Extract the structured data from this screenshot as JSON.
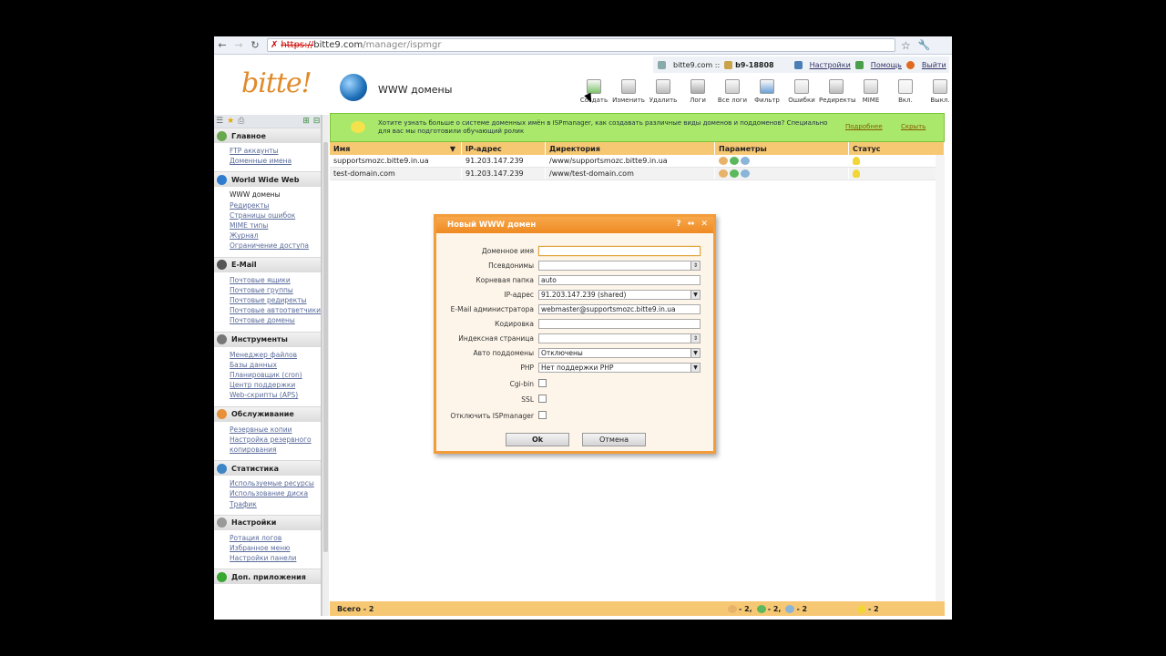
{
  "browser": {
    "url_scheme": "https://",
    "url_host": "bitte9.com",
    "url_path": "/manager/ispmgr"
  },
  "header": {
    "site": "bitte9.com ::",
    "account": "b9-18808",
    "settings": "Настройки",
    "help": "Помощь",
    "logout": "Выйти",
    "logo": "bitte!",
    "page_title": "WWW домены"
  },
  "toolbar": [
    {
      "label": "Создать",
      "name": "create"
    },
    {
      "label": "Изменить",
      "name": "edit"
    },
    {
      "label": "Удалить",
      "name": "delete"
    },
    {
      "label": "Логи",
      "name": "logs"
    },
    {
      "label": "Все логи",
      "name": "all-logs"
    },
    {
      "label": "Фильтр",
      "name": "filter"
    },
    {
      "label": "Ошибки",
      "name": "errors"
    },
    {
      "label": "Редиректы",
      "name": "redirects"
    },
    {
      "label": "MIME",
      "name": "mime"
    },
    {
      "label": "Вкл.",
      "name": "enable"
    },
    {
      "label": "Выкл.",
      "name": "disable"
    }
  ],
  "sidebar": {
    "sections": [
      {
        "title": "Главное",
        "color": "#6aa84f",
        "items": [
          "FTP аккаунты",
          "Доменные имена"
        ]
      },
      {
        "title": "World Wide Web",
        "color": "#2f7bd0",
        "items": [
          "WWW домены",
          "Редиректы",
          "Страницы ошибок",
          "MIME типы",
          "Журнал",
          "Ограничение доступа"
        ]
      },
      {
        "title": "E-Mail",
        "color": "#555555",
        "items": [
          "Почтовые ящики",
          "Почтовые группы",
          "Почтовые редиректы",
          "Почтовые автоответчики",
          "Почтовые домены"
        ]
      },
      {
        "title": "Инструменты",
        "color": "#777777",
        "items": [
          "Менеджер файлов",
          "Базы данных",
          "Планировщик (cron)",
          "Центр поддержки",
          "Web-скрипты (APS)"
        ]
      },
      {
        "title": "Обслуживание",
        "color": "#e69138",
        "items": [
          "Резервные копии",
          "Настройка резервного копирования"
        ]
      },
      {
        "title": "Статистика",
        "color": "#3d85c6",
        "items": [
          "Используемые ресурсы",
          "Использование диска",
          "Трафик"
        ]
      },
      {
        "title": "Настройки",
        "color": "#999999",
        "items": [
          "Ротация логов",
          "Избранное меню",
          "Настройки панели"
        ]
      },
      {
        "title": "Доп. приложения",
        "color": "#38a832",
        "items": []
      }
    ]
  },
  "banner": {
    "text": "Хотите узнать больше о системе доменных имён в ISPmanager, как создавать различные виды доменов и поддоменов? Специально для вас мы подготовили обучающий ролик",
    "more": "Подробнее",
    "hide": "Скрыть"
  },
  "table": {
    "headers": [
      "Имя",
      "IP-адрес",
      "Директория",
      "Параметры",
      "Статус"
    ],
    "rows": [
      {
        "name": "supportsmozc.bitte9.in.ua",
        "ip": "91.203.147.239",
        "dir": "/www/supportsmozc.bitte9.in.ua"
      },
      {
        "name": "test-domain.com",
        "ip": "91.203.147.239",
        "dir": "/www/test-domain.com"
      }
    ],
    "footer_total": "Всего - 2",
    "footer_counts": [
      "- 2,",
      "- 2,",
      "- 2",
      "- 2"
    ]
  },
  "dialog": {
    "title": "Новый WWW домен",
    "fields": {
      "domain": {
        "label": "Доменное имя",
        "value": ""
      },
      "aliases": {
        "label": "Псевдонимы",
        "value": ""
      },
      "root": {
        "label": "Корневая папка",
        "value": "auto"
      },
      "ip": {
        "label": "IP-адрес",
        "value": "91.203.147.239 (shared)"
      },
      "email": {
        "label": "E-Mail администратора",
        "value": "webmaster@supportsmozc.bitte9.in.ua"
      },
      "charset": {
        "label": "Кодировка",
        "value": ""
      },
      "index": {
        "label": "Индексная страница",
        "value": ""
      },
      "autosub": {
        "label": "Авто поддомены",
        "value": "Отключены"
      },
      "php": {
        "label": "PHP",
        "value": "Нет поддержки PHP"
      },
      "cgi": {
        "label": "Cgi-bin"
      },
      "ssl": {
        "label": "SSL"
      },
      "noisp": {
        "label": "Отключить ISPmanager"
      }
    },
    "ok": "Ok",
    "cancel": "Отмена"
  }
}
